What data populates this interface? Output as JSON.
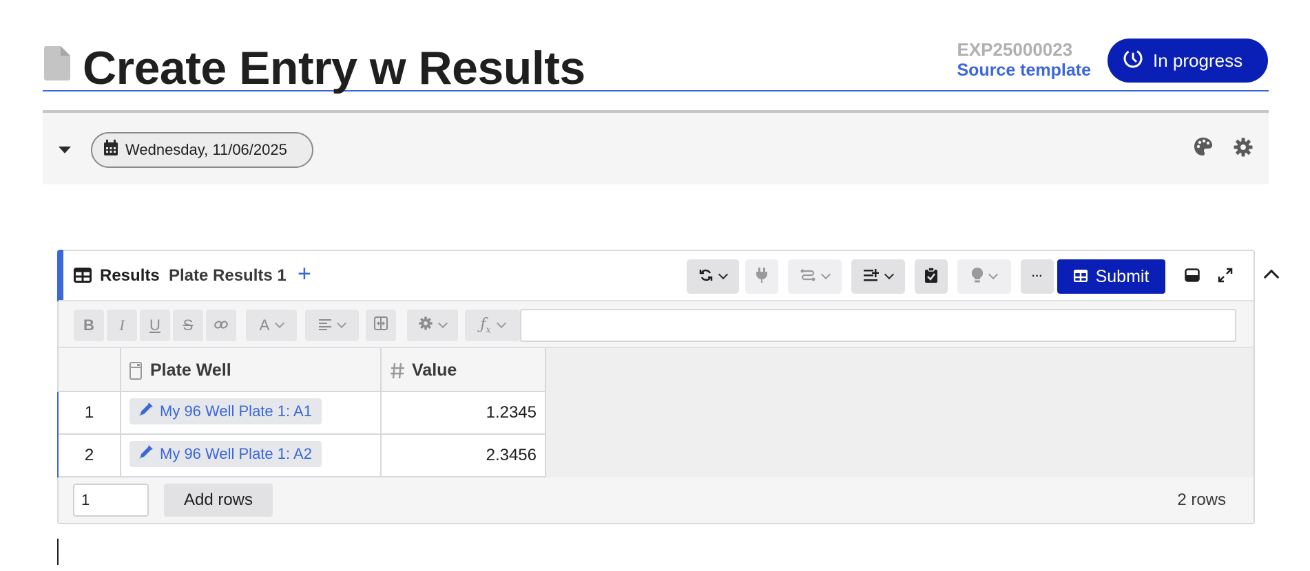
{
  "header": {
    "title": "Create Entry w Results",
    "experiment_id": "EXP25000023",
    "source_link": "Source template",
    "status_label": "In progress"
  },
  "date_bar": {
    "date": "Wednesday, 11/06/2025"
  },
  "results_panel": {
    "title": "Results",
    "tabs": [
      {
        "label": "Plate Results 1"
      }
    ],
    "add_tab": "+",
    "submit_label": "Submit",
    "more_label": "···",
    "formula_value": "",
    "columns": [
      {
        "label": "Plate Well",
        "icon": "plate-icon"
      },
      {
        "label": "Value",
        "icon": "hash-icon"
      }
    ],
    "rows": [
      {
        "num": "1",
        "plate_well": "My 96 Well Plate 1: A1",
        "value": "1.2345"
      },
      {
        "num": "2",
        "plate_well": "My 96 Well Plate 1: A2",
        "value": "2.3456"
      }
    ],
    "footer": {
      "rows_to_add": "1",
      "add_rows_label": "Add rows",
      "row_count": "2 rows"
    }
  },
  "colors": {
    "accent": "#3b67d9",
    "primary_button": "#0a1fb5"
  }
}
